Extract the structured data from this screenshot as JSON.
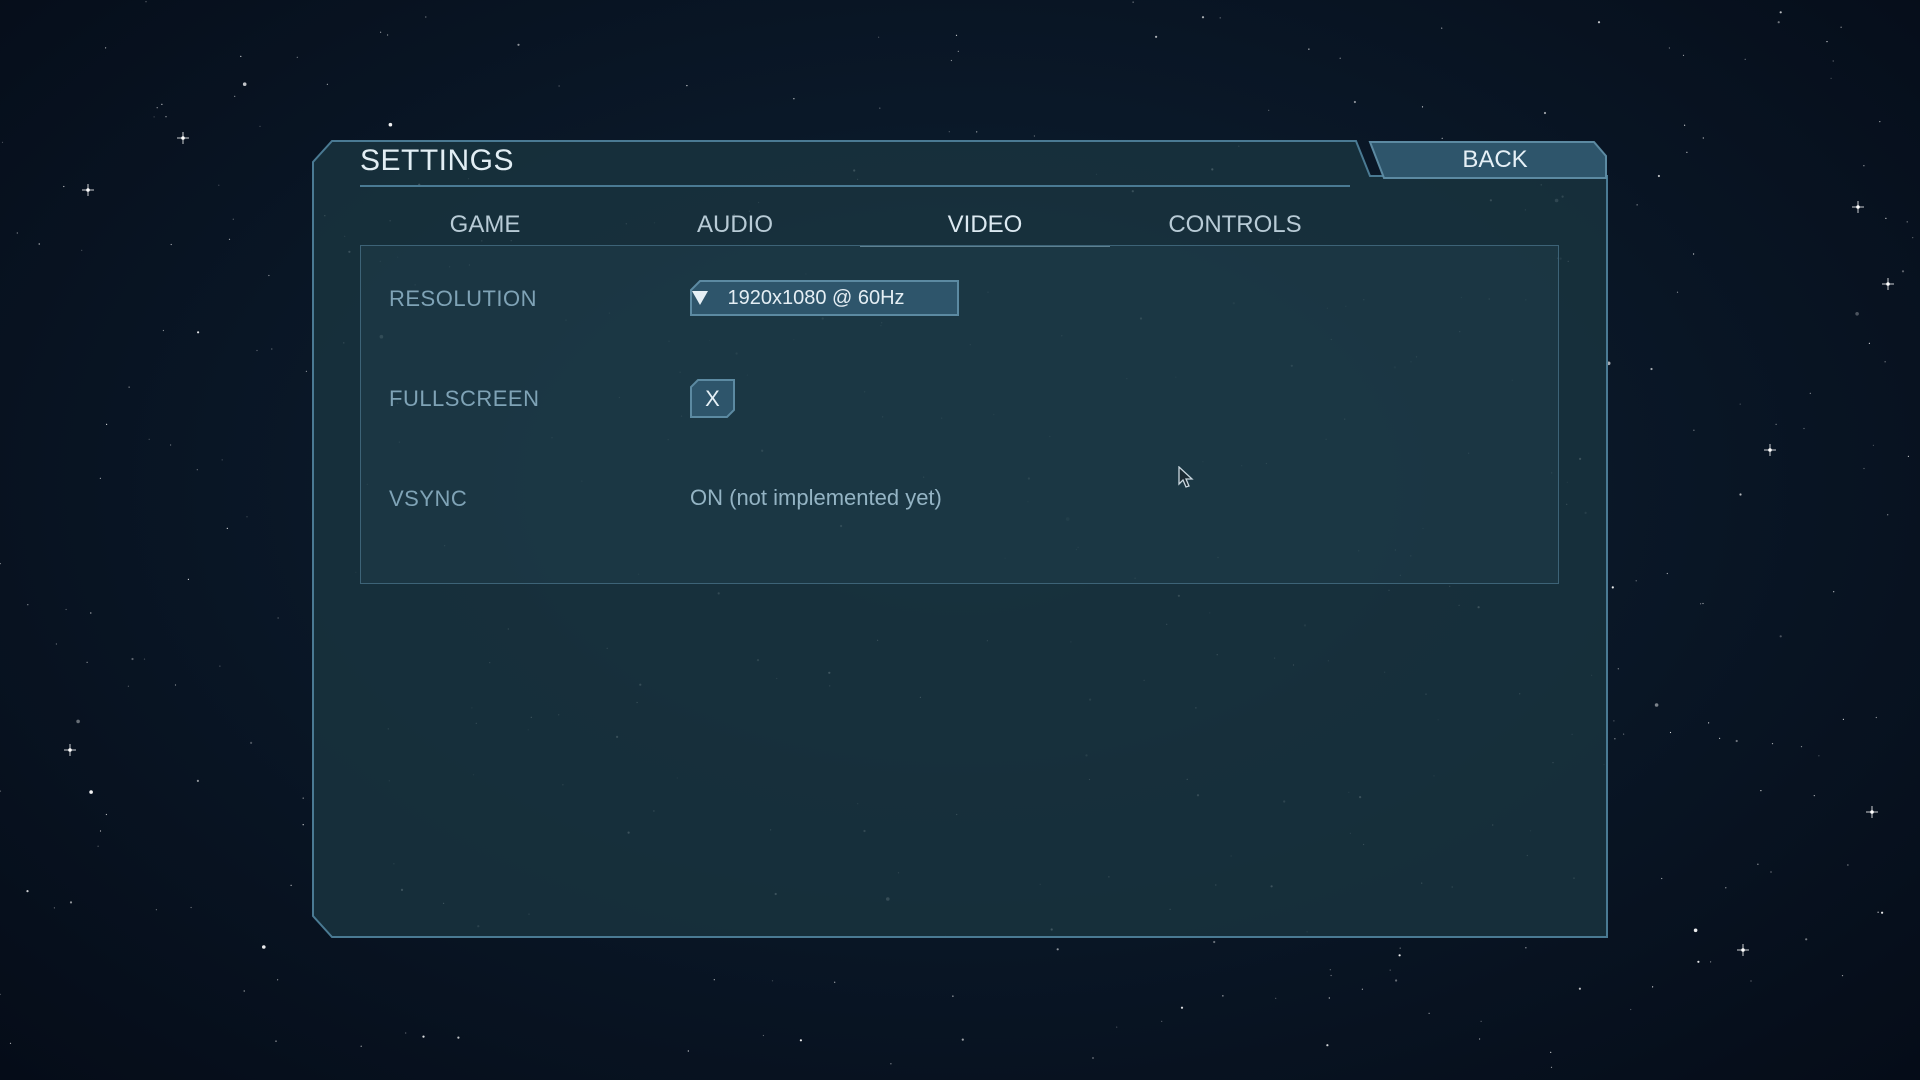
{
  "screen": {
    "title": "SETTINGS",
    "back_label": "BACK"
  },
  "tabs": [
    {
      "label": "GAME",
      "active": false
    },
    {
      "label": "AUDIO",
      "active": false
    },
    {
      "label": "VIDEO",
      "active": true
    },
    {
      "label": "CONTROLS",
      "active": false
    }
  ],
  "video": {
    "resolution": {
      "label": "RESOLUTION",
      "value": "1920x1080 @ 60Hz"
    },
    "fullscreen": {
      "label": "FULLSCREEN",
      "mark": "X",
      "checked": true
    },
    "vsync": {
      "label": "VSYNC",
      "value": "ON (not implemented yet)"
    }
  },
  "icons": {
    "dropdown": "triangle-down-icon",
    "pointer": "mouse-cursor-icon"
  },
  "colors": {
    "panel_fill": "#1a3440",
    "panel_border": "#4a7a93",
    "accent": "#8fb4c8",
    "label_text": "#7fa3b6",
    "value_text": "#94b4c4",
    "button_fill": "#2e556b"
  }
}
